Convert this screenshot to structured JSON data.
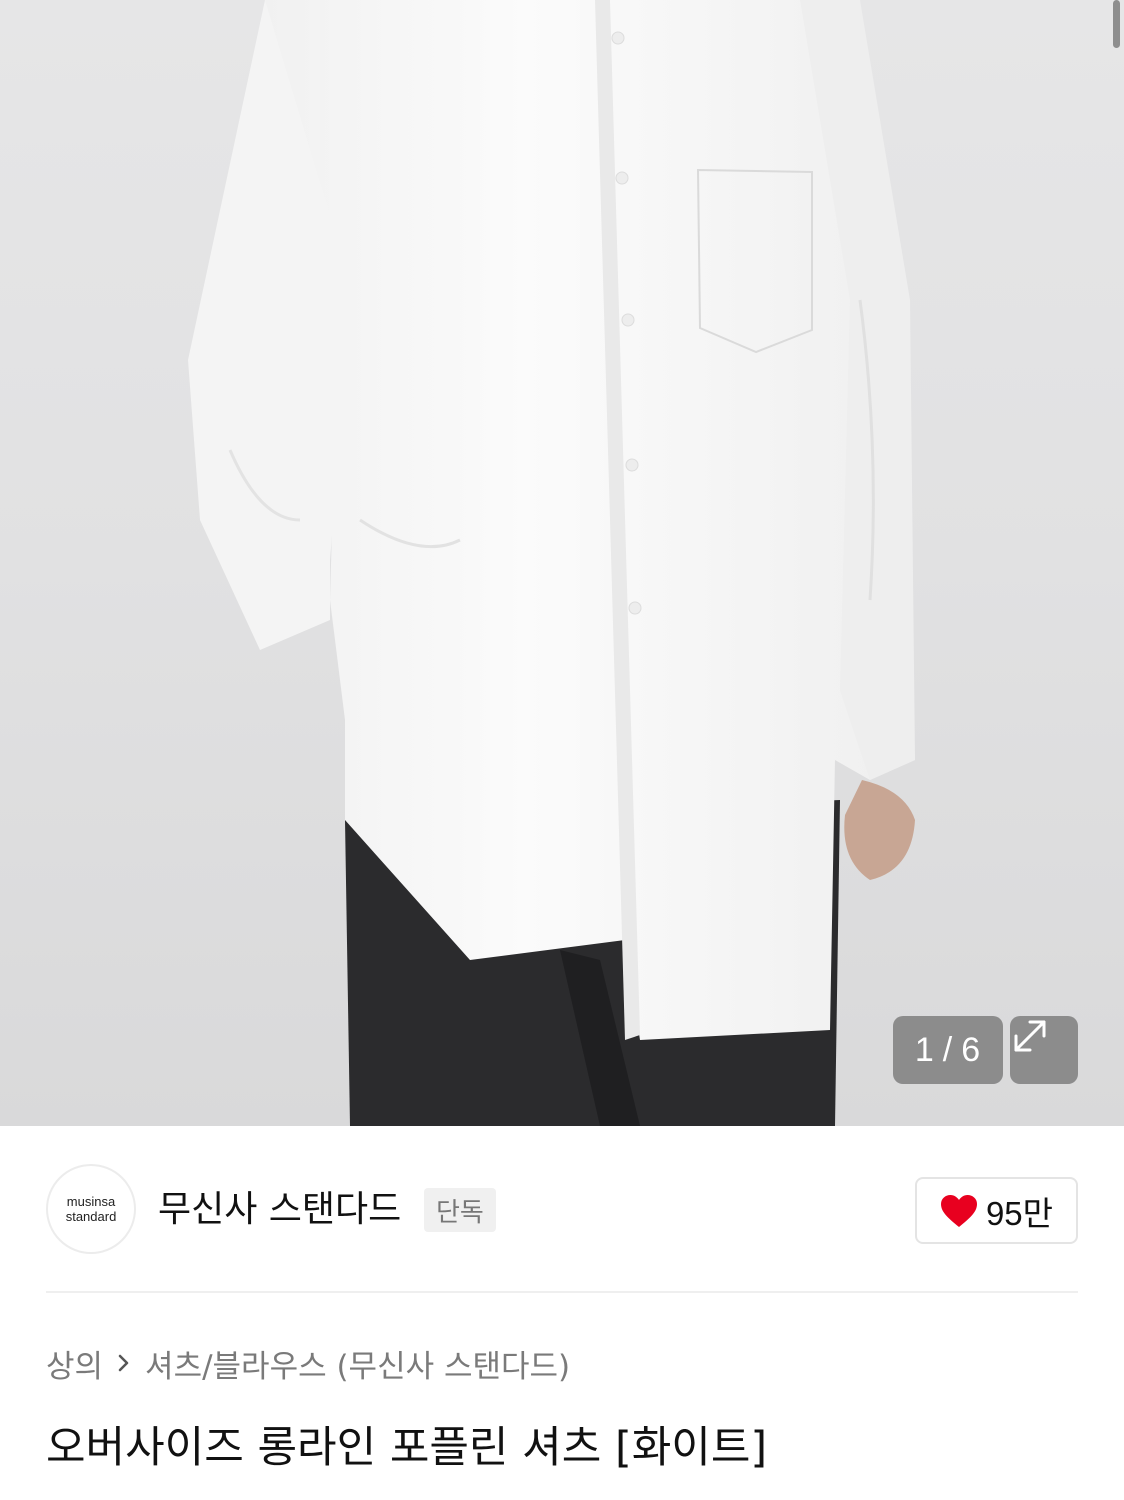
{
  "gallery": {
    "current_index": "1",
    "separator": "/",
    "total": "6",
    "expand_icon": "expand-arrows-icon"
  },
  "brand": {
    "logo_line1": "musinsa",
    "logo_line2": "standard",
    "name": "무신사 스탠다드",
    "badge": "단독"
  },
  "like": {
    "icon": "heart-icon",
    "count": "95만",
    "color": "#e8001f"
  },
  "breadcrumb": {
    "level1": "상의",
    "level2": "셔츠/블라우스 (무신사 스탠다드)"
  },
  "product": {
    "title": "오버사이즈 롱라인 포플린 셔츠 [화이트]"
  }
}
